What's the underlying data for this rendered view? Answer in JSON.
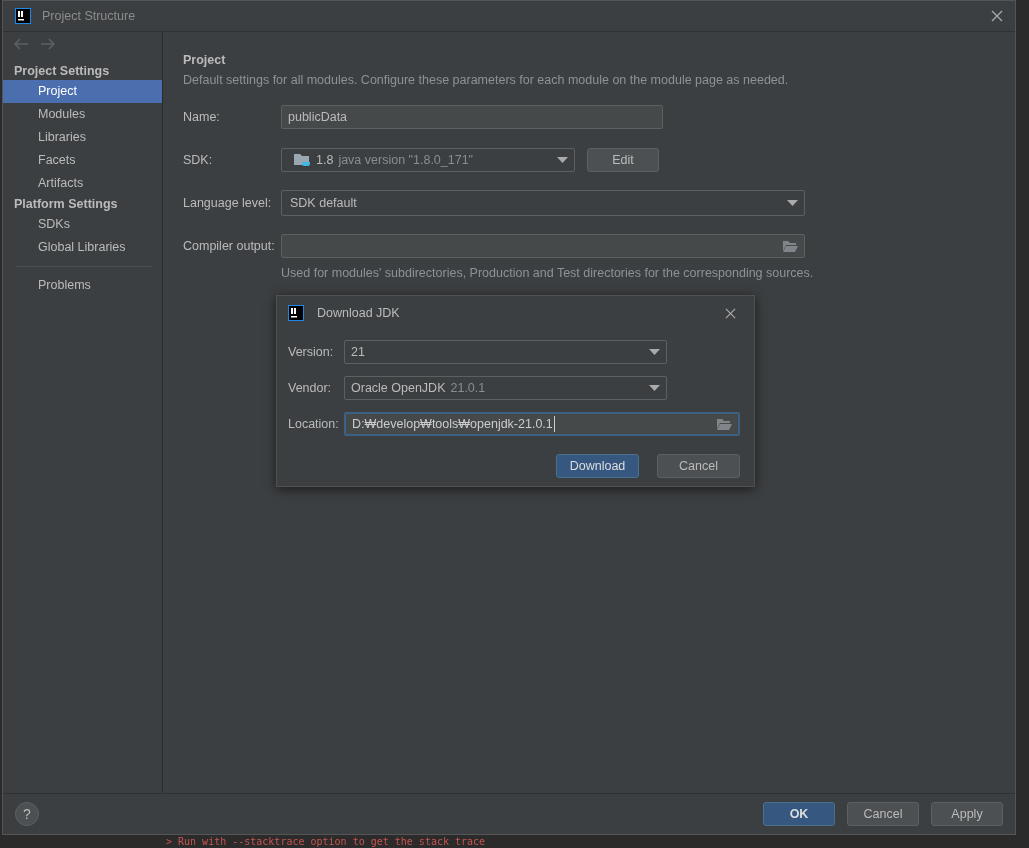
{
  "window": {
    "title": "Project Structure"
  },
  "sidebar": {
    "sections": [
      {
        "title": "Project Settings",
        "items": [
          {
            "label": "Project",
            "selected": true
          },
          {
            "label": "Modules",
            "selected": false
          },
          {
            "label": "Libraries",
            "selected": false
          },
          {
            "label": "Facets",
            "selected": false
          },
          {
            "label": "Artifacts",
            "selected": false
          }
        ]
      },
      {
        "title": "Platform Settings",
        "items": [
          {
            "label": "SDKs",
            "selected": false
          },
          {
            "label": "Global Libraries",
            "selected": false
          }
        ]
      }
    ],
    "extra_items": [
      {
        "label": "Problems",
        "selected": false
      }
    ]
  },
  "project": {
    "heading": "Project",
    "description": "Default settings for all modules. Configure these parameters for each module on the module page as needed.",
    "name": {
      "label": "Name:",
      "value": "publicData"
    },
    "sdk": {
      "label": "SDK:",
      "version": "1.8",
      "detail": "java version \"1.8.0_171\"",
      "button": "Edit"
    },
    "language_level": {
      "label": "Language level:",
      "value": "SDK default"
    },
    "compiler_output": {
      "label": "Compiler output:",
      "hint": "Used for modules' subdirectories, Production and Test directories for the corresponding sources."
    }
  },
  "dialog": {
    "title": "Download JDK",
    "version": {
      "label": "Version:",
      "value": "21"
    },
    "vendor": {
      "label": "Vendor:",
      "value": "Oracle OpenJDK",
      "detail": "21.0.1"
    },
    "location": {
      "label": "Location:",
      "value": "D:₩develop₩tools₩openjdk-21.0.1",
      "focused": true
    },
    "buttons": [
      {
        "label": "Download",
        "primary": true
      },
      {
        "label": "Cancel",
        "primary": false
      }
    ]
  },
  "footer": {
    "help": "?",
    "buttons": [
      {
        "label": "OK",
        "primary": true
      },
      {
        "label": "Cancel",
        "primary": false
      },
      {
        "label": "Apply",
        "primary": false
      }
    ]
  },
  "console": {
    "line": "> Run with --stacktrace option to get the stack trace"
  }
}
